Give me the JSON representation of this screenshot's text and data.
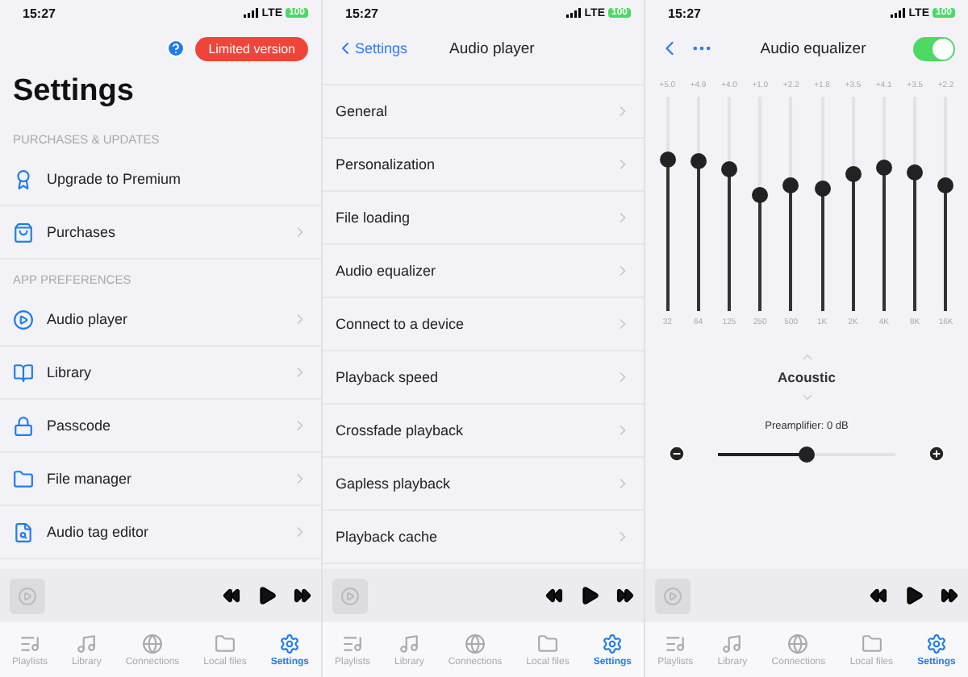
{
  "settings_screen": {
    "status_bar": {
      "time": "15:27",
      "network": "LTE",
      "battery": "100"
    },
    "limited_badge": "Limited version",
    "title": "Settings",
    "sections": [
      {
        "header": "PURCHASES & UPDATES",
        "items": [
          {
            "label": "Upgrade to Premium",
            "chevron": false
          },
          {
            "label": "Purchases",
            "chevron": true
          }
        ]
      },
      {
        "header": "APP PREFERENCES",
        "items": [
          {
            "label": "Audio player",
            "chevron": true
          },
          {
            "label": "Library",
            "chevron": true
          },
          {
            "label": "Passcode",
            "chevron": true
          },
          {
            "label": "File manager",
            "chevron": true
          },
          {
            "label": "Audio tag editor",
            "chevron": true
          }
        ]
      }
    ],
    "tab_bar": [
      {
        "label": "Playlists",
        "selected": false
      },
      {
        "label": "Library",
        "selected": false
      },
      {
        "label": "Connections",
        "selected": false
      },
      {
        "label": "Local files",
        "selected": false
      },
      {
        "label": "Settings",
        "selected": true
      }
    ]
  },
  "audio_player_screen": {
    "status_bar": {
      "time": "15:27",
      "network": "LTE",
      "battery": "100"
    },
    "back": "Settings",
    "title": "Audio player",
    "items": [
      {
        "label": "General"
      },
      {
        "label": "Personalization"
      },
      {
        "label": "File loading"
      },
      {
        "label": "Audio equalizer"
      },
      {
        "label": "Connect to a device"
      },
      {
        "label": "Playback speed"
      },
      {
        "label": "Crossfade playback"
      },
      {
        "label": "Gapless playback"
      },
      {
        "label": "Playback cache"
      }
    ],
    "tab_bar": [
      {
        "label": "Playlists",
        "selected": false
      },
      {
        "label": "Library",
        "selected": false
      },
      {
        "label": "Connections",
        "selected": false
      },
      {
        "label": "Local files",
        "selected": false
      },
      {
        "label": "Settings",
        "selected": true
      }
    ]
  },
  "equalizer_screen": {
    "status_bar": {
      "time": "15:27",
      "network": "LTE",
      "battery": "100"
    },
    "title": "Audio equalizer",
    "enabled": {
      "on": true
    },
    "bands": [
      {
        "reading": "+5.0",
        "label": "32",
        "level": 0.71
      },
      {
        "reading": "+4.9",
        "label": "64",
        "level": 0.7
      },
      {
        "reading": "+4.0",
        "label": "125",
        "level": 0.66
      },
      {
        "reading": "+1.0",
        "label": "250",
        "level": 0.54
      },
      {
        "reading": "+2.2",
        "label": "500",
        "level": 0.59
      },
      {
        "reading": "+1.8",
        "label": "1K",
        "level": 0.57
      },
      {
        "reading": "+3.5",
        "label": "2K",
        "level": 0.64
      },
      {
        "reading": "+4.1",
        "label": "4K",
        "level": 0.67
      },
      {
        "reading": "+3.5",
        "label": "8K",
        "level": 0.65
      },
      {
        "reading": "+2.2",
        "label": "16K",
        "level": 0.59
      }
    ],
    "preset": "Acoustic",
    "preamp": {
      "label": "Preamplifier: 0 dB",
      "level": 0.5
    },
    "tab_bar": [
      {
        "label": "Playlists",
        "selected": false
      },
      {
        "label": "Library",
        "selected": false
      },
      {
        "label": "Connections",
        "selected": false
      },
      {
        "label": "Local files",
        "selected": false
      },
      {
        "label": "Settings",
        "selected": true
      }
    ]
  }
}
